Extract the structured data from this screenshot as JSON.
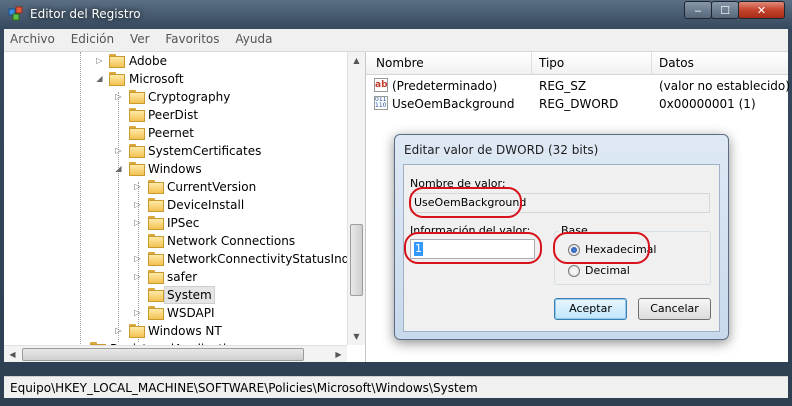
{
  "window": {
    "title": "Editor del Registro",
    "minimize": "‒",
    "maximize": "☐",
    "close": "✕"
  },
  "menu": [
    "Archivo",
    "Edición",
    "Ver",
    "Favoritos",
    "Ayuda"
  ],
  "tree": {
    "adobe": "Adobe",
    "microsoft": "Microsoft",
    "cryptography": "Cryptography",
    "peerdist": "PeerDist",
    "peernet": "Peernet",
    "systemcertificates": "SystemCertificates",
    "windows": "Windows",
    "currentversion": "CurrentVersion",
    "deviceinstall": "DeviceInstall",
    "ipsec": "IPSec",
    "network_connections": "Network Connections",
    "ncsi": "NetworkConnectivityStatusIndicat",
    "safer": "safer",
    "system": "System",
    "wsdapi": "WSDAPI",
    "windows_nt": "Windows NT",
    "registered_apps": "RegisteredApplications"
  },
  "list": {
    "headers": {
      "name": "Nombre",
      "type": "Tipo",
      "data": "Datos"
    },
    "rows": [
      {
        "name": "(Predeterminado)",
        "type": "REG_SZ",
        "data": "(valor no establecido)",
        "icon": "ab"
      },
      {
        "name": "UseOemBackground",
        "type": "REG_DWORD",
        "data": "0x00000001 (1)",
        "icon": "011\n110"
      }
    ]
  },
  "status_path": "Equipo\\HKEY_LOCAL_MACHINE\\SOFTWARE\\Policies\\Microsoft\\Windows\\System",
  "dialog": {
    "title": "Editar valor de DWORD (32 bits)",
    "name_label": "Nombre de valor:",
    "name_value": "UseOemBackground",
    "data_label": "Información del valor:",
    "data_value": "1",
    "base_label": "Base",
    "hex_label": "Hexadecimal",
    "dec_label": "Decimal",
    "ok": "Aceptar",
    "cancel": "Cancelar",
    "base_selected": "Hexadecimal"
  },
  "colors": {
    "highlight_oval": "#d8121a",
    "folder": "#f2c251"
  }
}
